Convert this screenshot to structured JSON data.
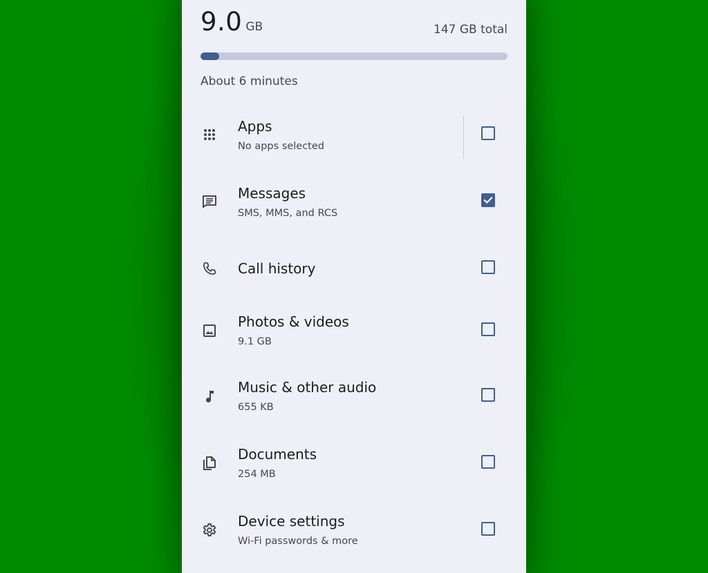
{
  "storage": {
    "used_value": "9.0",
    "used_unit": "GB",
    "total_label": "147 GB total",
    "progress_fraction": 0.06,
    "eta_label": "About 6 minutes"
  },
  "colors": {
    "accent": "#3f5f90",
    "track": "#c3cade",
    "surface": "#eff0f7",
    "background": "#008a00"
  },
  "items": [
    {
      "icon": "apps-grid-icon",
      "title": "Apps",
      "subtitle": "No apps selected",
      "checked": false
    },
    {
      "icon": "message-icon",
      "title": "Messages",
      "subtitle": "SMS, MMS, and RCS",
      "checked": true
    },
    {
      "icon": "phone-icon",
      "title": "Call history",
      "subtitle": "",
      "checked": false
    },
    {
      "icon": "image-icon",
      "title": "Photos & videos",
      "subtitle": "9.1 GB",
      "checked": false
    },
    {
      "icon": "music-note-icon",
      "title": "Music & other audio",
      "subtitle": "655 KB",
      "checked": false
    },
    {
      "icon": "documents-icon",
      "title": "Documents",
      "subtitle": "254 MB",
      "checked": false
    },
    {
      "icon": "gear-icon",
      "title": "Device settings",
      "subtitle": "Wi-Fi passwords & more",
      "checked": false
    }
  ]
}
